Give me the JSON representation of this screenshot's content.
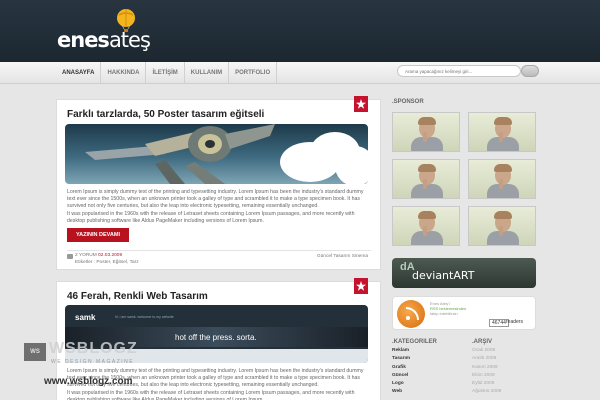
{
  "header": {
    "logo_bold": "enes",
    "logo_light": "ateş"
  },
  "nav": {
    "items": [
      "ANASAYFA",
      "HAKKINDA",
      "İLETİŞİM",
      "KULLANIM",
      "PORTFOLIO"
    ]
  },
  "search": {
    "placeholder": "Arama yapacağınız kelimeyi giri..."
  },
  "posts": [
    {
      "title": "Farklı tarzlarda, 50 Poster tasarım eğitseli",
      "p1": "Lorem Ipsum is simply dummy text of the printing and typesetting industry. Lorem Ipsum has been the industry's standard dummy text ever since the 1500s, when an unknown printer took a galley of type and scrambled it to make a type specimen book. It has survived not only five centuries, but also the leap into electronic typesetting, remaining essentially unchanged.",
      "p2": "It was popularised in the 1960s with the release of Letraset sheets containing Lorem Ipsum passages, and more recently with desktop publishing software like Aldus PageMaker including versions of Lorem Ipsum.",
      "read_more": "YAZININ DEVAMI",
      "comments": "2 YORUM",
      "date": "02.03.2009",
      "tags": "Etiketler : Poster, Eğitsel, Tarz",
      "categories": "Güncel  Tasarım  Sinema"
    },
    {
      "title": "46 Ferah, Renkli Web Tasarım",
      "banner_brand": "samk",
      "banner_nav": "hi, i am samk. welcome to my website",
      "banner_tagline": "hot off the press. sorta.",
      "p1": "Lorem Ipsum is simply dummy text of the printing and typesetting industry. Lorem Ipsum has been the industry's standard dummy text ever since the 1500s, when an unknown printer took a galley of type and scrambled it to make a type specimen book. It has survived not only five centuries, but also the leap into electronic typesetting, remaining essentially unchanged.",
      "p2": "It was popularised in the 1960s with the release of Letraset sheets containing Lorem Ipsum passages, and more recently with desktop publishing software like Aldus PageMaker including versions of Lorem Ipsum."
    }
  ],
  "sidebar": {
    "sponsor_title": ".SPONSOR",
    "deviant_text": "deviantART",
    "feed": {
      "line1": "Enes Ateş'i",
      "line2": "RSS beslemesinden",
      "line3": "takip edebilirsin",
      "count": "46744",
      "readers": "readers"
    },
    "categories_title": ".KATEGORILER",
    "categories": [
      "Reklam",
      "Tasarım",
      "Grafik",
      "Güncel",
      "Logo",
      "Web"
    ],
    "archive_title": ".ARŞIV",
    "archive": [
      "Ocak 2009",
      "Aralık 2009",
      "Kasım 2009",
      "Ekim 2009",
      "Eylül 2009",
      "Ağustos 2009"
    ]
  },
  "watermark": {
    "box": "WS",
    "logo": "WSBLOGZ",
    "sub": "WE DESIGN MAGAZINE",
    "url": "www.wsblogz.com"
  },
  "colors": {
    "header_bg": "#1c2730",
    "accent_red": "#c4122f",
    "page_bg": "#e6e6e6"
  }
}
